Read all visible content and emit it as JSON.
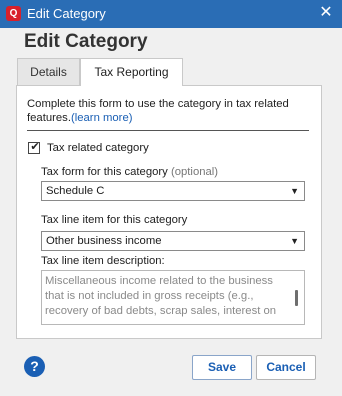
{
  "window": {
    "title": "Edit Category",
    "app_icon_glyph": "Q",
    "close_glyph": "✕",
    "accent_color": "#2a6db5"
  },
  "heading": "Edit Category",
  "tabs": [
    {
      "label": "Details",
      "active": false
    },
    {
      "label": "Tax Reporting",
      "active": true
    }
  ],
  "tax_reporting": {
    "intro_text": "Complete this form to use the category in tax related features.",
    "learn_more": "(learn more)",
    "tax_related": {
      "label": "Tax related category",
      "checked": true,
      "check_glyph": "✔"
    },
    "tax_form": {
      "label": "Tax form for this category",
      "optional": "(optional)",
      "value": "Schedule C"
    },
    "tax_line": {
      "label": "Tax line item for this category",
      "value": "Other business income"
    },
    "description": {
      "label": "Tax line item description:",
      "text": "Miscellaneous income related to the business that is not included in gross receipts (e.g., recovery of bad debts, scrap sales, interest on"
    }
  },
  "footer": {
    "help_glyph": "?",
    "save_label": "Save",
    "cancel_label": "Cancel"
  }
}
